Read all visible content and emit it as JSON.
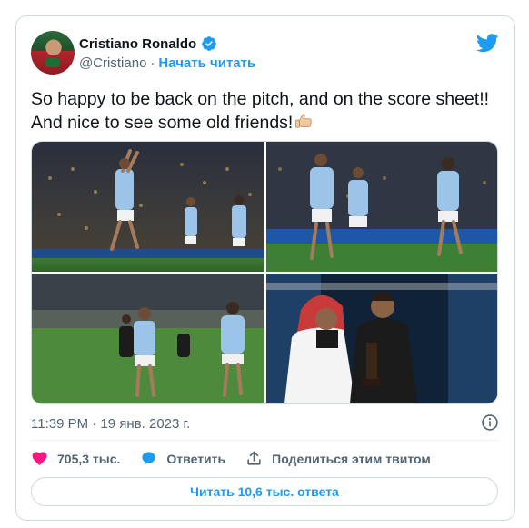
{
  "author": {
    "name": "Cristiano Ronaldo",
    "handle": "@Cristiano",
    "separator": "·",
    "follow_label": "Начать читать",
    "verified": true
  },
  "tweet": {
    "text_line1": "So happy to be back on the pitch, and on the score sheet!!",
    "text_line2": "And nice to see some old friends!",
    "emoji": "thumbs-up-icon"
  },
  "media": [
    {
      "alt_name": "photo-celebration-jump"
    },
    {
      "alt_name": "photo-teammates-running"
    },
    {
      "alt_name": "photo-players-on-pitch"
    },
    {
      "alt_name": "photo-trophy-presentation"
    }
  ],
  "meta": {
    "timestamp": "11:39 PM · 19 янв. 2023 г."
  },
  "actions": {
    "likes_count": "705,3 тыс.",
    "reply_label": "Ответить",
    "share_label": "Поделиться этим твитом"
  },
  "replies_button_label": "Читать 10,6 тыс. ответа",
  "colors": {
    "accent": "#1d9bf0",
    "like": "#f91880",
    "text": "#0f1419",
    "secondary": "#536471",
    "border": "#cfd9de"
  }
}
